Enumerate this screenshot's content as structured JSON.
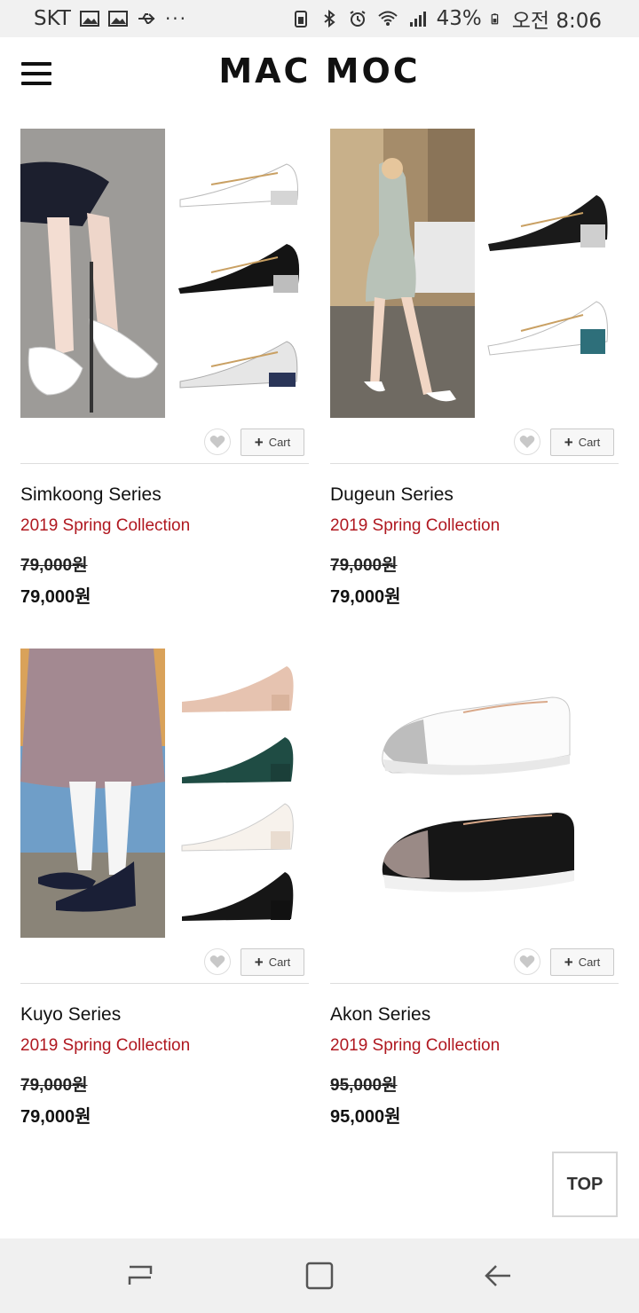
{
  "status_bar": {
    "carrier": "SKT",
    "dots": "···",
    "battery": "43%",
    "time": "오전 8:06"
  },
  "header": {
    "brand": "MAC MOC"
  },
  "products": [
    {
      "name": "Simkoong Series",
      "collection": "2019 Spring Collection",
      "original_price": "79,000원",
      "sale_price": "79,000원",
      "cart_label": "Cart"
    },
    {
      "name": "Dugeun Series",
      "collection": "2019 Spring Collection",
      "original_price": "79,000원",
      "sale_price": "79,000원",
      "cart_label": "Cart"
    },
    {
      "name": "Kuyo Series",
      "collection": "2019 Spring Collection",
      "original_price": "79,000원",
      "sale_price": "79,000원",
      "cart_label": "Cart"
    },
    {
      "name": "Akon Series",
      "collection": "2019 Spring Collection",
      "original_price": "95,000원",
      "sale_price": "95,000원",
      "cart_label": "Cart"
    }
  ],
  "top_button": "TOP",
  "colors": {
    "accent": "#b01820",
    "text": "#111111",
    "divider": "#dddddd"
  }
}
